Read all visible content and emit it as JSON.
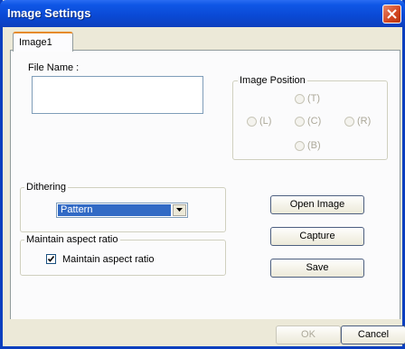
{
  "window": {
    "title": "Image Settings"
  },
  "tabs": [
    {
      "label": "Image1",
      "selected": true
    }
  ],
  "file": {
    "label": "File Name :",
    "value": ""
  },
  "image_position": {
    "legend": "Image Position",
    "options": [
      {
        "label": "(T)",
        "enabled": false
      },
      {
        "label": "(L)",
        "enabled": false
      },
      {
        "label": "(C)",
        "enabled": false
      },
      {
        "label": "(R)",
        "enabled": false
      },
      {
        "label": "(B)",
        "enabled": false
      }
    ]
  },
  "dithering": {
    "legend": "Dithering",
    "selected": "Pattern"
  },
  "aspect": {
    "legend": "Maintain aspect ratio",
    "checkbox_label": "Maintain aspect ratio",
    "checked": true
  },
  "buttons": {
    "open_image": "Open Image",
    "capture": "Capture",
    "save": "Save",
    "ok": "OK",
    "cancel": "Cancel"
  },
  "colors": {
    "titlebar": "#0a49d4",
    "accent_tab": "#e68b2c",
    "selection": "#316ac5",
    "close": "#d2451f"
  }
}
